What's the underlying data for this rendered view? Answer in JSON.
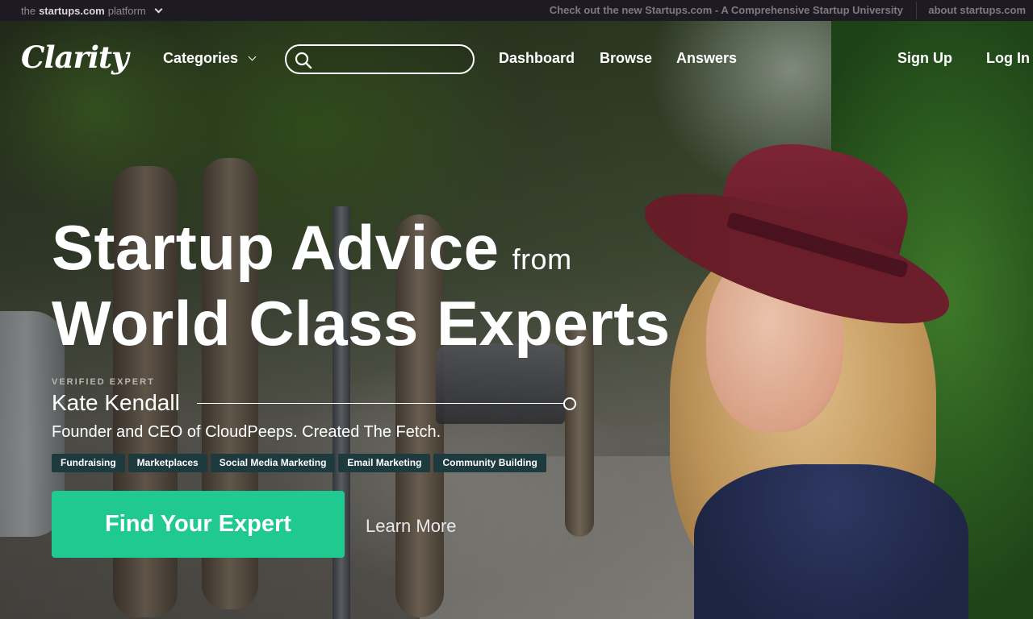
{
  "topbar": {
    "brand_prefix": "the",
    "brand_name": "startups.com",
    "brand_suffix": "platform",
    "promo": "Check out the new Startups.com - A Comprehensive Startup University",
    "about": "about startups.com"
  },
  "nav": {
    "logo": "Clarity",
    "categories": "Categories",
    "search_value": "",
    "links": [
      "Dashboard",
      "Browse",
      "Answers"
    ],
    "sign_up": "Sign Up",
    "log_in": "Log In"
  },
  "hero": {
    "headline_1": "Startup Advice",
    "headline_from": "from",
    "headline_2": "World Class Experts",
    "verified_label": "VERIFIED EXPERT",
    "expert_name": "Kate Kendall",
    "expert_description": "Founder and CEO of CloudPeeps. Created The Fetch.",
    "tags": [
      "Fundraising",
      "Marketplaces",
      "Social Media Marketing",
      "Email Marketing",
      "Community Building"
    ],
    "cta_label": "Find Your Expert",
    "learn_more": "Learn More"
  },
  "colors": {
    "cta": "#1fc98f",
    "tag_bg": "#1d3a3f",
    "topbar_bg": "#1d1a21",
    "hat": "#6e1f2b"
  }
}
